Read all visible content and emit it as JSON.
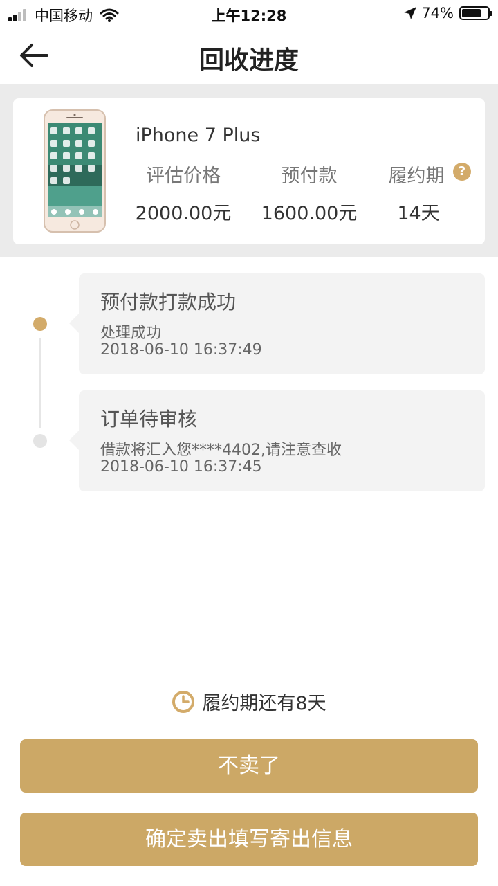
{
  "status_bar": {
    "carrier": "中国移动",
    "time": "上午12:28",
    "battery_percent": "74%",
    "battery_level": 0.74
  },
  "nav": {
    "title": "回收进度"
  },
  "product": {
    "name": "iPhone 7 Plus",
    "labels": {
      "estimated_price": "评估价格",
      "prepayment": "预付款",
      "contract_period": "履约期"
    },
    "values": {
      "estimated_price": "2000.00元",
      "prepayment": "1600.00元",
      "contract_period": "14天"
    },
    "help_icon": "?"
  },
  "timeline": [
    {
      "title": "预付款打款成功",
      "desc": "处理成功",
      "time": "2018-06-10 16:37:49",
      "active": true
    },
    {
      "title": "订单待审核",
      "desc": "借款将汇入您****4402,请注意查收",
      "time": "2018-06-10 16:37:45",
      "active": false
    }
  ],
  "countdown": {
    "text": "履约期还有8天",
    "icon": "clock-icon"
  },
  "buttons": {
    "cancel": "不卖了",
    "confirm": "确定卖出填写寄出信息"
  },
  "colors": {
    "accent": "#cca866",
    "dot_active": "#d3ab6a",
    "dot_inactive": "#e4e4e4",
    "section_bg": "#ebebeb",
    "card_bg": "#f3f3f3"
  }
}
